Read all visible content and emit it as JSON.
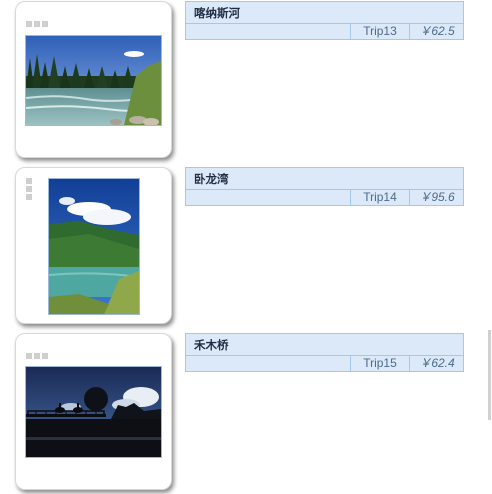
{
  "items": [
    {
      "title": "喀纳斯河",
      "trip": "Trip13",
      "price": "￥62.5",
      "image": "river-forest-landscape-photo"
    },
    {
      "title": "卧龙湾",
      "trip": "Trip14",
      "price": "￥95.6",
      "image": "lake-mountain-portrait-photo"
    },
    {
      "title": "禾木桥",
      "trip": "Trip15",
      "price": "￥62.4",
      "image": "bridge-horseriders-silhouette-photo"
    }
  ]
}
